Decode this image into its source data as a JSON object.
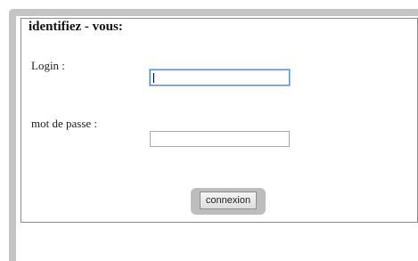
{
  "form": {
    "legend": "identifiez - vous:",
    "login_label": "Login :",
    "login_value": "",
    "password_label": "mot de passe :",
    "password_value": "",
    "submit_label": "connexion"
  }
}
